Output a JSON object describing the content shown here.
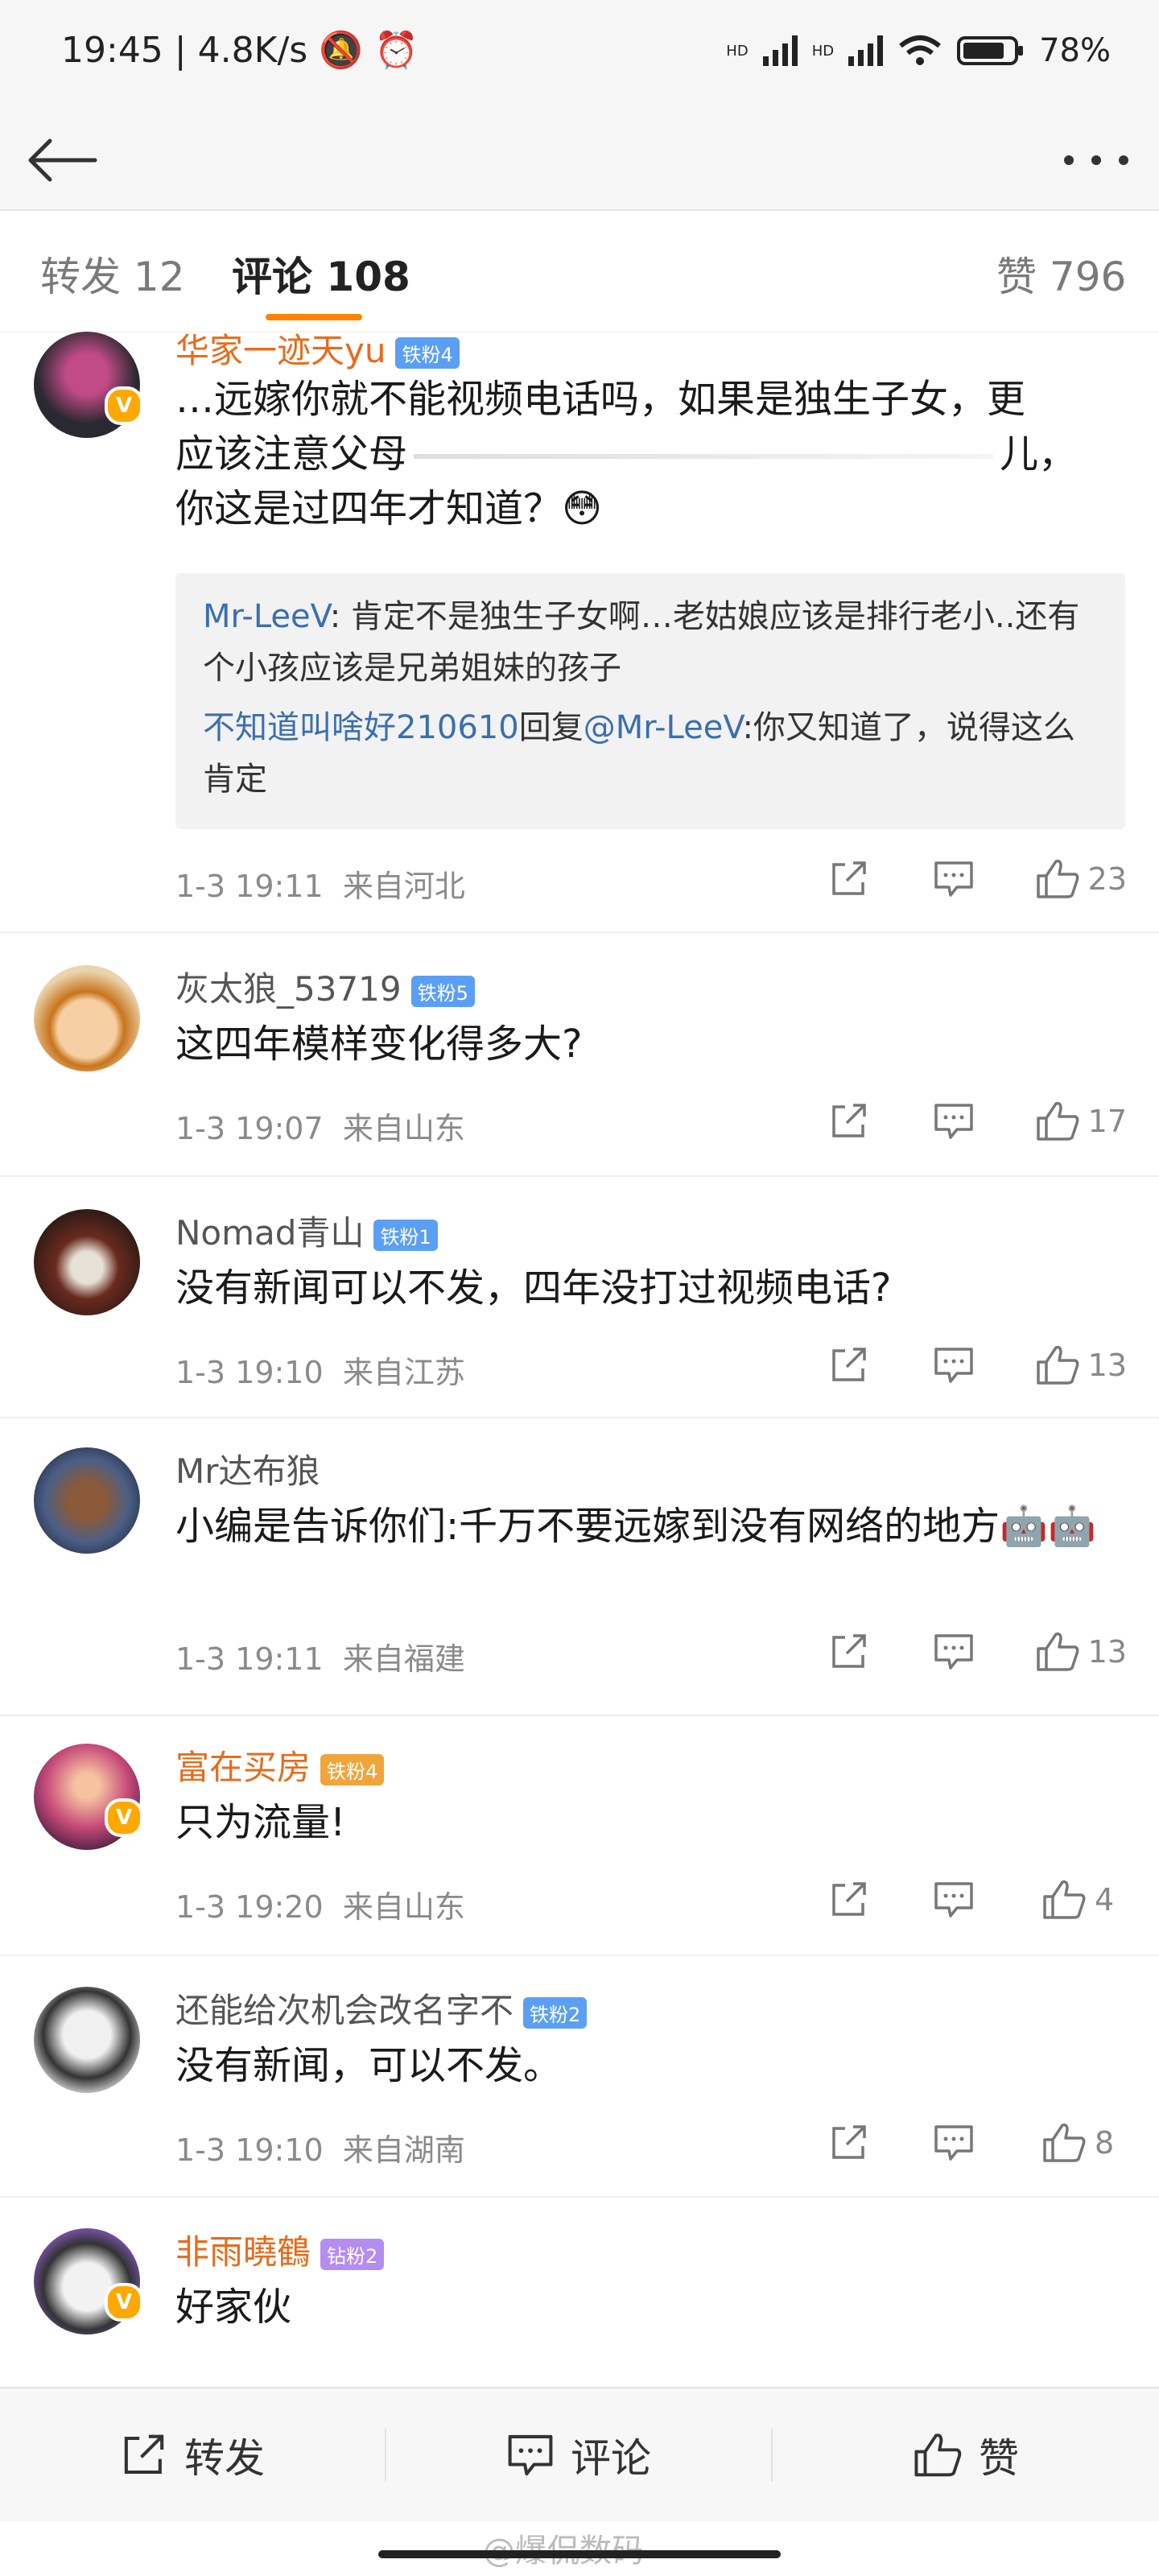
{
  "status_bar": {
    "time": "19:45",
    "speed": "4.8K/s",
    "battery": "78%",
    "hd1": "HD",
    "hd2": "HD"
  },
  "icons": {
    "back": "back-arrow-icon",
    "more": "more-dots-icon",
    "share": "share-icon",
    "comment": "comment-icon",
    "like": "thumbs-up-icon"
  },
  "tabs": {
    "repost": "转发 12",
    "comment": "评论 108",
    "like": "赞 796"
  },
  "comments": [
    {
      "name": "华家一迹天yu",
      "badge": "铁粉4",
      "verified": true,
      "text_lines": [
        "…远嫁你就不能视频电话吗，如果是独生子女，更",
        "应该注意父母",
        "儿，",
        "你这是过四年才知道？😳"
      ],
      "quote": {
        "user1": "Mr-LeeV",
        "text1": ": 肯定不是独生子女啊…老姑娘应该是排行老小..还有个小孩应该是兄弟姐妹的孩子",
        "user2": "不知道叫啥好210610",
        "reply_word": "回复",
        "user3": "@Mr-LeeV",
        "text2": ":你又知道了，说得这么肯定"
      },
      "time": "1-3 19:11",
      "location": "来自河北",
      "likes": "23"
    },
    {
      "name": "灰太狼_53719",
      "badge": "铁粉5",
      "text": "这四年模样变化得多大?",
      "time": "1-3 19:07",
      "location": "来自山东",
      "likes": "17"
    },
    {
      "name": "Nomad青山",
      "badge": "铁粉1",
      "text": "没有新闻可以不发，四年没打过视频电话?",
      "time": "1-3 19:10",
      "location": "来自江苏",
      "likes": "13"
    },
    {
      "name": "Mr达布狼",
      "text": "小编是告诉你们:千万不要远嫁到没有网络的地方🤖🤖",
      "time": "1-3 19:11",
      "location": "来自福建",
      "likes": "13"
    },
    {
      "name": "富在买房",
      "badge": "铁粉4",
      "verified": true,
      "text": "只为流量!",
      "time": "1-3 19:20",
      "location": "来自山东",
      "likes": "4"
    },
    {
      "name": "还能给次机会改名字不",
      "badge": "铁粉2",
      "text": "没有新闻，可以不发。",
      "time": "1-3 19:10",
      "location": "来自湖南",
      "likes": "8"
    },
    {
      "name": "非雨曉鶴",
      "badge": "钻粉2",
      "verified": true,
      "text": "好家伙"
    }
  ],
  "bottom_bar": {
    "repost": "转发",
    "comment": "评论",
    "like": "赞"
  },
  "watermark": "@爆侃数码",
  "colors": {
    "accent": "#ff8200",
    "gold_name": "#e86b1a",
    "link_blue": "#3a6fb0",
    "fan_blue": "#5b9ff5",
    "fan_purple": "#b58cf0"
  }
}
